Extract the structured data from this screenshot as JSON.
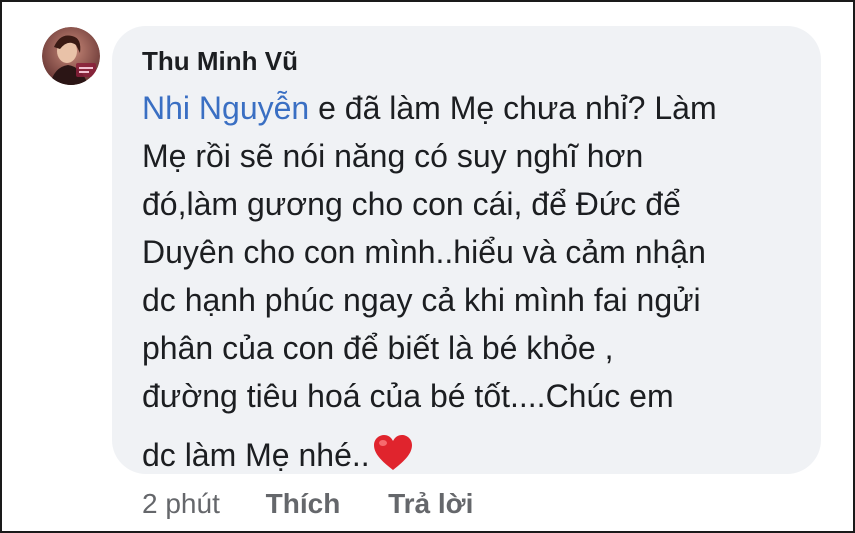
{
  "comment": {
    "author": "Thu Minh Vũ",
    "mention": "Nhi Nguyễn",
    "lines": [
      " e đã làm Mẹ chưa nhỉ? Làm",
      "Mẹ rồi sẽ nói năng có suy nghĩ hơn",
      "đó,làm gương cho con cái, để Đức để",
      "Duyên cho con mình..hiểu và cảm nhận",
      "dc hạnh phúc ngay cả khi mình fai ngửi",
      "phân của con để biết là bé khỏe ,",
      "đường tiêu hoá của bé tốt....Chúc em",
      "dc làm Mẹ nhé.."
    ],
    "emoji": "heart-emoji"
  },
  "footer": {
    "time": "2 phút",
    "like_label": "Thích",
    "reply_label": "Trả lời"
  },
  "colors": {
    "bubble_bg": "#f0f2f5",
    "mention": "#3a6fc3",
    "meta_text": "#65676b",
    "heart": "#e0242d"
  }
}
